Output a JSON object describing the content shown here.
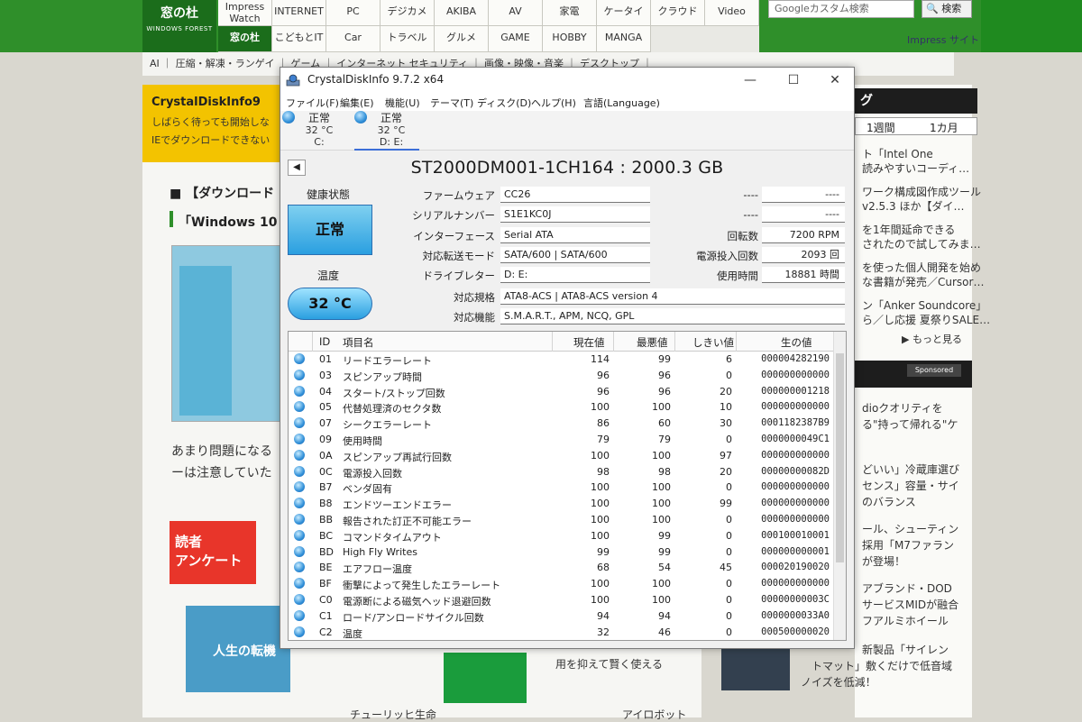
{
  "site": {
    "logo_text": "窓の杜",
    "logo_sub": "WINDOWS FOREST",
    "nav_top": [
      "Impress Watch",
      "INTERNET",
      "PC",
      "デジカメ",
      "AKIBA",
      "AV",
      "家電",
      "ケータイ",
      "クラウド",
      "Video"
    ],
    "nav_bottom": [
      "窓の杜",
      "こどもとIT",
      "Car",
      "トラベル",
      "グルメ",
      "GAME",
      "HOBBY",
      "MANGA"
    ],
    "search_placeholder": "Googleカスタム検索",
    "search_button": "検索",
    "impress_link": "Impress サイト",
    "sub_nav": "AI ｜ 圧縮・解凍・ランゲイ ｜ ゲーム  ｜ インターネット  セキュリティ ｜ 画像・映像・音楽 ｜ デスクトップ ｜",
    "yellow_title": "CrystalDiskInfo9",
    "yellow_line1": "しばらく待っても開始しな",
    "yellow_line2": "IEでダウンロードできない",
    "section1": "【ダウンロード",
    "section2": "「Windows 10",
    "para1": "あまり問題になる",
    "para2": "ーは注意していた",
    "survey_line1": "読者",
    "survey_line2": "アンケート",
    "ad_text": "人生の転機",
    "bottom_text1": "用を抑えて賢く使える",
    "bottom_text2": "チューリッヒ生命",
    "bottom_text3": "アイロボット",
    "ranking_title": "グ",
    "rank_tab1": "1週間",
    "rank_tab2": "1カ月",
    "right_items": [
      "ト「Intel One",
      "読みやすいコーディ…",
      "ワーク構成図作成ツール",
      "v2.5.3  ほか【ダイ…",
      "を1年間延命できる",
      "されたので試してみま…",
      "を使った個人開発を始め",
      "な書籍が発売／Cursor…",
      "ン「Anker Soundcore」",
      "ら／し応援 夏祭りSALE…"
    ],
    "more_link": "もっと見る",
    "sponsored": "Sponsored",
    "right_items2": [
      "dioクオリティを",
      "る\"持って帰れる\"ケ",
      "どいい」冷蔵庫選び",
      "センス」容量・サイ",
      "のバランス",
      "ール、シューティン",
      "採用「M7ファラン",
      "が登場！",
      "アブランド・DOD",
      "サービスMIDが融合",
      "フアルミホイール",
      "新製品「サイレン",
      "トマット」敷くだけで低音域",
      "ノイズを低減！"
    ]
  },
  "app": {
    "title": "CrystalDiskInfo 9.7.2 x64",
    "menu": [
      "ファイル(F)",
      "編集(E)",
      "機能(U)",
      "テーマ(T)",
      "ディスク(D)",
      "ヘルプ(H)",
      "言語(Language)"
    ],
    "drives": [
      {
        "status": "正常",
        "temp": "32 °C",
        "letter": "C:"
      },
      {
        "status": "正常",
        "temp": "32 °C",
        "letter": "D: E:"
      }
    ],
    "model": "ST2000DM001-1CH164 : 2000.3 GB",
    "health_label": "健康状態",
    "health_status": "正常",
    "temp_label": "温度",
    "temp_value": "32 °C",
    "fields": {
      "firmware_label": "ファームウェア",
      "firmware": "CC26",
      "serial_label": "シリアルナンバー",
      "serial": "S1E1KC0J",
      "interface_label": "インターフェース",
      "interface": "Serial ATA",
      "transfer_label": "対応転送モード",
      "transfer": "SATA/600 | SATA/600",
      "drive_letter_label": "ドライブレター",
      "drive_letter": "D: E:",
      "standard_label": "対応規格",
      "standard": "ATA8-ACS | ATA8-ACS version 4",
      "features_label": "対応機能",
      "features": "S.M.A.R.T., APM, NCQ, GPL"
    },
    "right_fields": {
      "blank1_label": "----",
      "blank1": "----",
      "blank2_label": "----",
      "blank2": "----",
      "rpm_label": "回転数",
      "rpm": "7200 RPM",
      "power_count_label": "電源投入回数",
      "power_count": "2093 回",
      "hours_label": "使用時間",
      "hours": "18881 時間"
    },
    "smart_headers": [
      "ID",
      "項目名",
      "現在値",
      "最悪値",
      "しきい値",
      "生の値"
    ],
    "smart_rows": [
      {
        "id": "01",
        "name": "リードエラーレート",
        "cur": "114",
        "worst": "99",
        "thr": "6",
        "raw": "000004282190"
      },
      {
        "id": "03",
        "name": "スピンアップ時間",
        "cur": "96",
        "worst": "96",
        "thr": "0",
        "raw": "000000000000"
      },
      {
        "id": "04",
        "name": "スタート/ストップ回数",
        "cur": "96",
        "worst": "96",
        "thr": "20",
        "raw": "000000001218"
      },
      {
        "id": "05",
        "name": "代替処理済のセクタ数",
        "cur": "100",
        "worst": "100",
        "thr": "10",
        "raw": "000000000000"
      },
      {
        "id": "07",
        "name": "シークエラーレート",
        "cur": "86",
        "worst": "60",
        "thr": "30",
        "raw": "0001182387B9"
      },
      {
        "id": "09",
        "name": "使用時間",
        "cur": "79",
        "worst": "79",
        "thr": "0",
        "raw": "0000000049C1"
      },
      {
        "id": "0A",
        "name": "スピンアップ再試行回数",
        "cur": "100",
        "worst": "100",
        "thr": "97",
        "raw": "000000000000"
      },
      {
        "id": "0C",
        "name": "電源投入回数",
        "cur": "98",
        "worst": "98",
        "thr": "20",
        "raw": "00000000082D"
      },
      {
        "id": "B7",
        "name": "ベンダ固有",
        "cur": "100",
        "worst": "100",
        "thr": "0",
        "raw": "000000000000"
      },
      {
        "id": "B8",
        "name": "エンドツーエンドエラー",
        "cur": "100",
        "worst": "100",
        "thr": "99",
        "raw": "000000000000"
      },
      {
        "id": "BB",
        "name": "報告された訂正不可能エラー",
        "cur": "100",
        "worst": "100",
        "thr": "0",
        "raw": "000000000000"
      },
      {
        "id": "BC",
        "name": "コマンドタイムアウト",
        "cur": "100",
        "worst": "99",
        "thr": "0",
        "raw": "000100010001"
      },
      {
        "id": "BD",
        "name": "High Fly Writes",
        "cur": "99",
        "worst": "99",
        "thr": "0",
        "raw": "000000000001"
      },
      {
        "id": "BE",
        "name": "エアフロー温度",
        "cur": "68",
        "worst": "54",
        "thr": "45",
        "raw": "000020190020"
      },
      {
        "id": "BF",
        "name": "衝撃によって発生したエラーレート",
        "cur": "100",
        "worst": "100",
        "thr": "0",
        "raw": "000000000000"
      },
      {
        "id": "C0",
        "name": "電源断による磁気ヘッド退避回数",
        "cur": "100",
        "worst": "100",
        "thr": "0",
        "raw": "00000000003C"
      },
      {
        "id": "C1",
        "name": "ロード/アンロードサイクル回数",
        "cur": "94",
        "worst": "94",
        "thr": "0",
        "raw": "0000000033A0"
      },
      {
        "id": "C2",
        "name": "温度",
        "cur": "32",
        "worst": "46",
        "thr": "0",
        "raw": "000500000020"
      }
    ]
  }
}
